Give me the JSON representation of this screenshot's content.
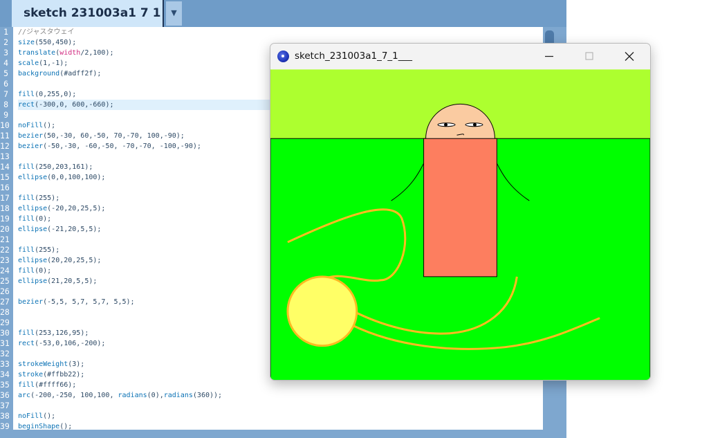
{
  "ide": {
    "tab_label": "sketch 231003a1 7 1",
    "tab_dropdown_glyph": "▼",
    "highlighted_line": 8,
    "code_lines": [
      {
        "n": "1",
        "t": "//ジャスタウェイ"
      },
      {
        "n": "2",
        "t": "size(550,450);"
      },
      {
        "n": "3",
        "t": "translate(width/2,100);"
      },
      {
        "n": "4",
        "t": "scale(1,-1);"
      },
      {
        "n": "5",
        "t": "background(#adff2f);"
      },
      {
        "n": "6",
        "t": ""
      },
      {
        "n": "7",
        "t": "fill(0,255,0);"
      },
      {
        "n": "8",
        "t": "rect(-300,0, 600,-660);"
      },
      {
        "n": "9",
        "t": ""
      },
      {
        "n": "10",
        "t": "noFill();"
      },
      {
        "n": "11",
        "t": "bezier(50,-30, 60,-50, 70,-70, 100,-90);"
      },
      {
        "n": "12",
        "t": "bezier(-50,-30, -60,-50, -70,-70, -100,-90);"
      },
      {
        "n": "13",
        "t": ""
      },
      {
        "n": "14",
        "t": "fill(250,203,161);"
      },
      {
        "n": "15",
        "t": "ellipse(0,0,100,100);"
      },
      {
        "n": "16",
        "t": ""
      },
      {
        "n": "17",
        "t": "fill(255);"
      },
      {
        "n": "18",
        "t": "ellipse(-20,20,25,5);"
      },
      {
        "n": "19",
        "t": "fill(0);"
      },
      {
        "n": "20",
        "t": "ellipse(-21,20,5,5);"
      },
      {
        "n": "21",
        "t": ""
      },
      {
        "n": "22",
        "t": "fill(255);"
      },
      {
        "n": "23",
        "t": "ellipse(20,20,25,5);"
      },
      {
        "n": "24",
        "t": "fill(0);"
      },
      {
        "n": "25",
        "t": "ellipse(21,20,5,5);"
      },
      {
        "n": "26",
        "t": ""
      },
      {
        "n": "27",
        "t": "bezier(-5,5, 5,7, 5,7, 5,5);"
      },
      {
        "n": "28",
        "t": ""
      },
      {
        "n": "29",
        "t": ""
      },
      {
        "n": "30",
        "t": "fill(253,126,95);"
      },
      {
        "n": "31",
        "t": "rect(-53,0,106,-200);"
      },
      {
        "n": "32",
        "t": ""
      },
      {
        "n": "33",
        "t": "strokeWeight(3);"
      },
      {
        "n": "34",
        "t": "stroke(#ffbb22);"
      },
      {
        "n": "35",
        "t": "fill(#ffff66);"
      },
      {
        "n": "36",
        "t": "arc(-200,-250, 100,100, radians(0),radians(360));"
      },
      {
        "n": "37",
        "t": ""
      },
      {
        "n": "38",
        "t": "noFill();"
      },
      {
        "n": "39",
        "t": "beginShape();"
      }
    ]
  },
  "sketch_window": {
    "title": "sketch_231003a1_7_1___",
    "controls": {
      "minimize": "─",
      "maximize": "☐",
      "close": "✕"
    }
  },
  "colors": {
    "background": "#adff2f",
    "ground": "#00ff00",
    "face": "#facba1",
    "body": "#fd7e5f",
    "ball_fill": "#ffff66",
    "ball_stroke": "#ffbb22",
    "code_keyword": "#0b72b5",
    "code_text": "#2c4864",
    "code_comment": "#8a8a8a",
    "code_builtin": "#d1287f"
  }
}
